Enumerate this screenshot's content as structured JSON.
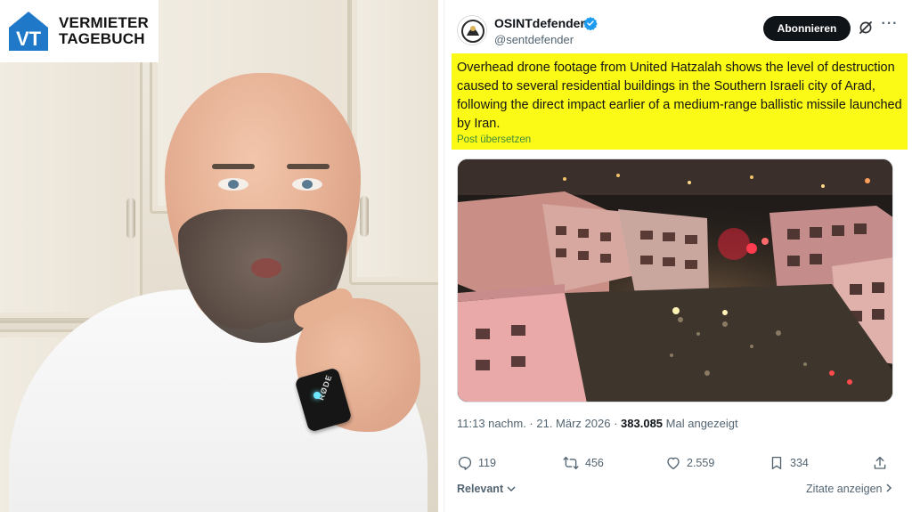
{
  "channel": {
    "logo_text_line1": "VERMIETER",
    "logo_text_line2": "TAGEBUCH",
    "logo_mark_letters": "VT",
    "brand_color": "#1f78c8"
  },
  "video": {
    "mic_label": "RØDE"
  },
  "tweet": {
    "display_name": "OSINTdefender",
    "handle": "@sentdefender",
    "follow_label": "Abonnieren",
    "more_label": "···",
    "text": "Overhead drone footage from United Hatzalah shows the level of destruction caused to several residential buildings in the Southern Israeli city of Arad, following the direct impact earlier of a medium-range ballistic missile launched by Iran.",
    "translate_label": "Post übersetzen",
    "highlight_color": "#fafa16",
    "timestamp": "11:13 nachm. · 21. März 2026 ·",
    "views_count": "383.085",
    "views_label": "Mal angezeigt",
    "replies": "119",
    "reposts": "456",
    "likes": "2.559",
    "bookmarks": "334",
    "sort_label": "Relevant",
    "quotes_label": "Zitate anzeigen"
  }
}
